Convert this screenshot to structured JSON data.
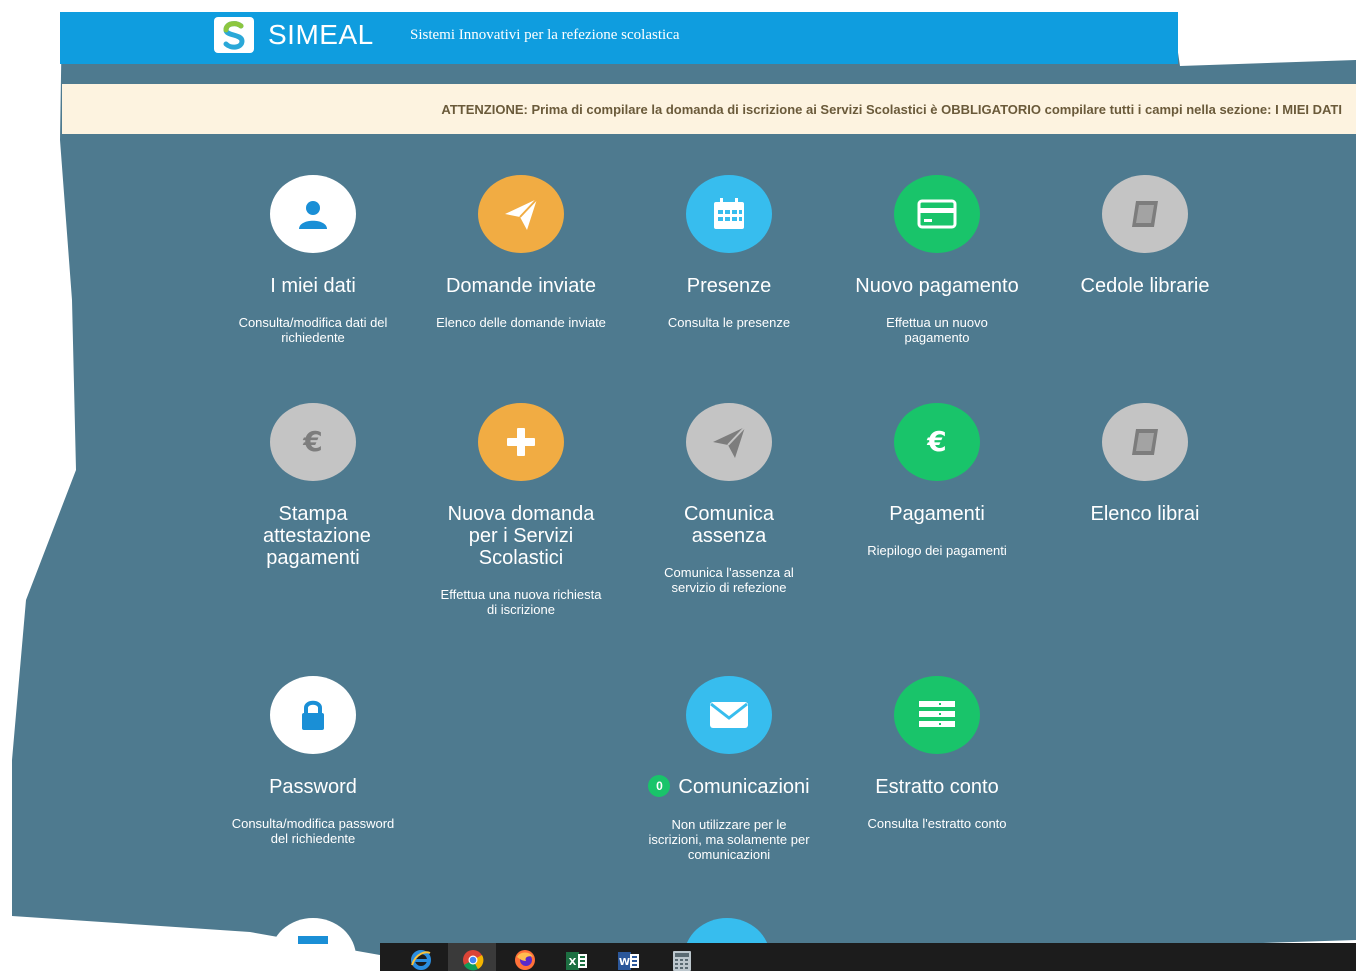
{
  "header": {
    "brand": "SIMEAL",
    "tagline": "Sistemi Innovativi per la refezione scolastica"
  },
  "notice": {
    "text": "ATTENZIONE: Prima di compilare la domanda di iscrizione ai Servizi Scolastici è OBBLIGATORIO compilare tutti i campi nella sezione: I MIEI DATI"
  },
  "tiles": [
    {
      "title": "I miei dati",
      "desc": "Consulta/modifica dati del richiedente",
      "icon": "user-icon",
      "color": "#ffffff"
    },
    {
      "title": "Domande inviate",
      "desc": "Elenco delle domande inviate",
      "icon": "paper-plane-icon",
      "color": "#f1ac43"
    },
    {
      "title": "Presenze",
      "desc": "Consulta le presenze",
      "icon": "calendar-icon",
      "color": "#37bdee"
    },
    {
      "title": "Nuovo pagamento",
      "desc": "Effettua un nuovo pagamento",
      "icon": "credit-card-icon",
      "color": "#19c46a"
    },
    {
      "title": "Cedole librarie",
      "desc": "",
      "icon": "book-icon",
      "color": "#c4c4c4"
    },
    {
      "title": "Stampa attestazione pagamenti",
      "desc": "",
      "icon": "euro-icon",
      "color": "#c4c4c4"
    },
    {
      "title": "Nuova domanda per i Servizi Scolastici",
      "desc": "Effettua una nuova richiesta di iscrizione",
      "icon": "plus-icon",
      "color": "#f1ac43"
    },
    {
      "title": "Comunica assenza",
      "desc": "Comunica l'assenza al servizio di refezione",
      "icon": "paper-plane-icon",
      "color": "#c4c4c4"
    },
    {
      "title": "Pagamenti",
      "desc": "Riepilogo dei pagamenti",
      "icon": "euro-icon",
      "color": "#19c46a"
    },
    {
      "title": "Elenco librai",
      "desc": "",
      "icon": "book-icon",
      "color": "#c4c4c4"
    },
    {
      "title": "Password",
      "desc": "Consulta/modifica password del richiedente",
      "icon": "lock-icon",
      "color": "#ffffff"
    },
    {
      "title": "Comunicazioni",
      "desc": "Non utilizzare per le iscrizioni, ma solamente per comunicazioni",
      "icon": "envelope-icon",
      "color": "#37bdee",
      "badge": "0"
    },
    {
      "title": "Estratto conto",
      "desc": "Consulta l'estratto conto",
      "icon": "list-icon",
      "color": "#19c46a"
    }
  ],
  "taskbar": {
    "apps": [
      "internet-explorer-icon",
      "chrome-icon",
      "firefox-icon",
      "excel-icon",
      "word-icon",
      "calculator-icon"
    ]
  }
}
